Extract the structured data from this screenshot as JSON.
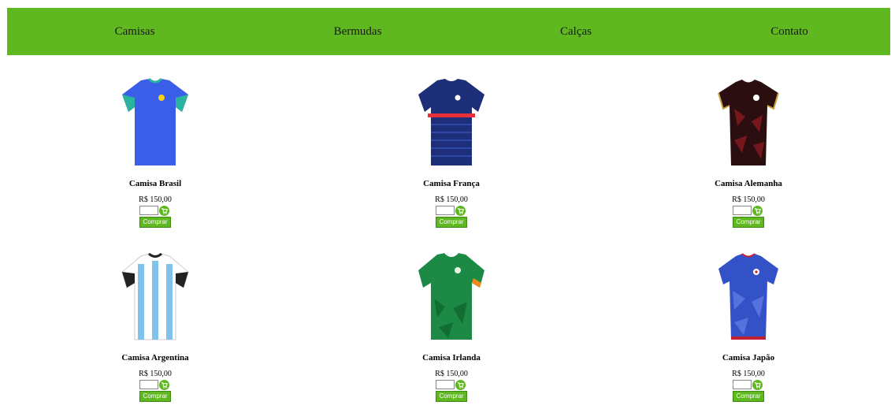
{
  "nav": {
    "items": [
      {
        "label": "Camisas"
      },
      {
        "label": "Bermudas"
      },
      {
        "label": "Calças"
      },
      {
        "label": "Contato"
      }
    ]
  },
  "products": [
    {
      "name": "Camisa Brasil",
      "price": "R$ 150,00",
      "buy_label": "Comprar",
      "qty": "",
      "icon": "brazil-shirt-icon",
      "colors": {
        "main": "#3a5ee8",
        "accent": "#2bb3a0"
      }
    },
    {
      "name": "Camisa França",
      "price": "R$ 150,00",
      "buy_label": "Comprar",
      "qty": "",
      "icon": "france-shirt-icon",
      "colors": {
        "main": "#1e2f7a",
        "accent": "#e8303a"
      }
    },
    {
      "name": "Camisa Alemanha",
      "price": "R$ 150,00",
      "buy_label": "Comprar",
      "qty": "",
      "icon": "germany-shirt-icon",
      "colors": {
        "main": "#2a0e10",
        "accent": "#8a1a22"
      }
    },
    {
      "name": "Camisa Argentina",
      "price": "R$ 150,00",
      "buy_label": "Comprar",
      "qty": "",
      "icon": "argentina-shirt-icon",
      "colors": {
        "main": "#ffffff",
        "accent": "#7fc3ec"
      }
    },
    {
      "name": "Camisa Irlanda",
      "price": "R$ 150,00",
      "buy_label": "Comprar",
      "qty": "",
      "icon": "ireland-shirt-icon",
      "colors": {
        "main": "#1c8a45",
        "accent": "#f08a1c"
      }
    },
    {
      "name": "Camisa Japão",
      "price": "R$ 150,00",
      "buy_label": "Comprar",
      "qty": "",
      "icon": "japan-shirt-icon",
      "colors": {
        "main": "#3452c8",
        "accent": "#c02030"
      }
    }
  ],
  "theme": {
    "accent": "#5fb820"
  }
}
